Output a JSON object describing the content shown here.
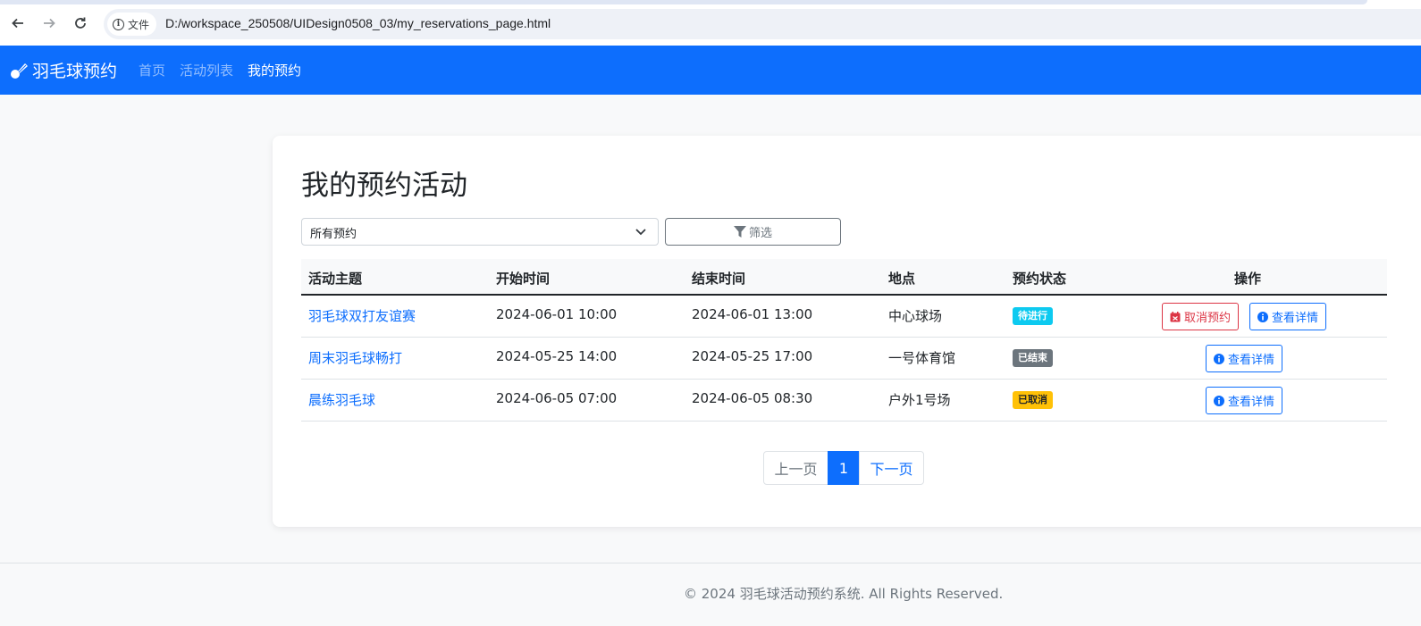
{
  "browser": {
    "back_icon": "arrow-left-icon",
    "forward_icon": "arrow-right-icon",
    "reload_icon": "reload-icon",
    "chip_label": "文件",
    "url": "D:/workspace_250508/UIDesign0508_03/my_reservations_page.html"
  },
  "navbar": {
    "brand": "羽毛球预约",
    "links": [
      {
        "label": "首页"
      },
      {
        "label": "活动列表"
      },
      {
        "label": "我的预约"
      }
    ],
    "color": "#0d6efd"
  },
  "main": {
    "title": "我的预约活动",
    "filter": {
      "selected": "所有预约",
      "button_label": "筛选"
    },
    "table": {
      "headers": [
        "活动主题",
        "开始时间",
        "结束时间",
        "地点",
        "预约状态",
        "操作"
      ],
      "rows": [
        {
          "topic": "羽毛球双打友谊赛",
          "start": "2024-06-01 10:00",
          "end": "2024-06-01 13:00",
          "location": "中心球场",
          "status": "待进行",
          "status_color": "#0dcaf0",
          "cancel_label": "取消预约",
          "detail_label": "查看详情"
        },
        {
          "topic": "周末羽毛球畅打",
          "start": "2024-05-25 14:00",
          "end": "2024-05-25 17:00",
          "location": "一号体育馆",
          "status": "已结束",
          "status_color": "#6c757d",
          "detail_label": "查看详情"
        },
        {
          "topic": "晨练羽毛球",
          "start": "2024-06-05 07:00",
          "end": "2024-06-05 08:30",
          "location": "户外1号场",
          "status": "已取消",
          "status_color": "#ffc107",
          "detail_label": "查看详情"
        }
      ]
    },
    "pagination": {
      "prev": "上一页",
      "current": "1",
      "next": "下一页"
    }
  },
  "footer": {
    "text": "© 2024 羽毛球活动预约系统. All Rights Reserved."
  }
}
